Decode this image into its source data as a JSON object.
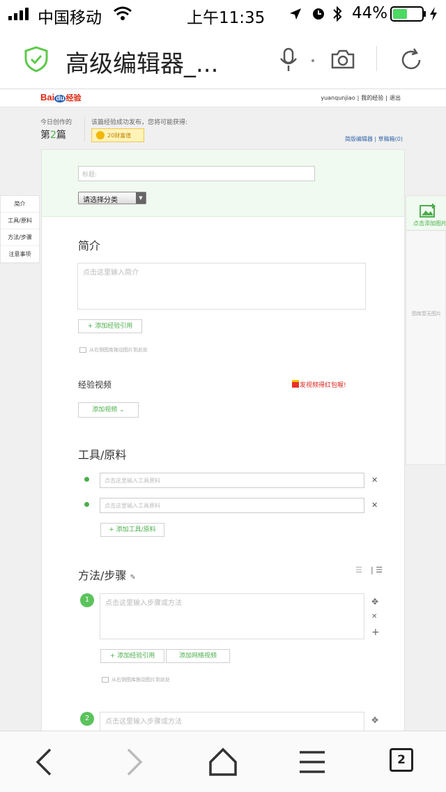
{
  "status_bar": {
    "carrier": "中国移动",
    "time": "上午11:35",
    "battery": "44%"
  },
  "address_bar": {
    "title": "高级编辑器_..."
  },
  "site": {
    "logo_text": "Bai",
    "logo_du": "du",
    "logo_suffix": "经验",
    "user_links": [
      "yuanqunjiao",
      "我的经验",
      "退出"
    ]
  },
  "info": {
    "today_label": "今日创作的",
    "count_prefix": "第",
    "count_value": "2",
    "count_suffix": "篇",
    "reward_text": "该篇经验成功发布，您将可能获得:",
    "reward_badge": "20财富值",
    "editor_links": [
      "简版编辑器",
      "草稿箱(0)"
    ]
  },
  "form": {
    "title_placeholder": "标题:",
    "category_select": "请选择分类",
    "intro_heading": "简介",
    "intro_placeholder": "点击这里输入简介",
    "add_ref_button": "+ 添加经验引用",
    "drag_hint": "从右侧图库拖动图片到此处",
    "video_heading": "经验视频",
    "video_promo": "发视频得红包喔!",
    "add_video_button": "添加视频",
    "tools_heading": "工具/原料",
    "tool_placeholder": "点击这里输入工具原料",
    "add_tool_button": "+ 添加工具/原料",
    "steps_heading": "方法/步骤",
    "step_placeholder": "点击这里输入步骤或方法",
    "step_add_ref_button": "+ 添加经验引用",
    "step_add_video_button": "添加网络视频",
    "step_numbers": [
      "1",
      "2"
    ]
  },
  "left_nav": [
    "简介",
    "工具/原料",
    "方法/步骤",
    "注意事项"
  ],
  "right_panel": {
    "add_image": "点击添加图片",
    "empty_text": "图库暂无图片"
  },
  "toolbar": {
    "tab_count": "2"
  }
}
